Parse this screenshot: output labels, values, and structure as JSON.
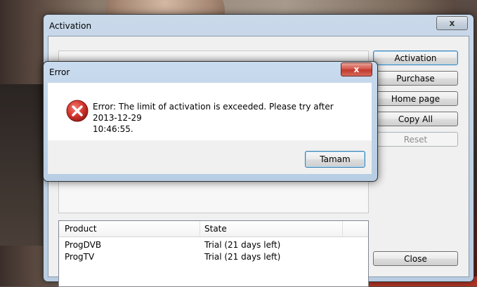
{
  "activation_window": {
    "title": "Activation",
    "close_symbol": "x",
    "buttons": {
      "activation": "Activation",
      "purchase": "Purchase",
      "home_page": "Home page",
      "copy_all": "Copy All",
      "reset": "Reset",
      "close": "Close"
    },
    "table": {
      "columns": [
        "Product",
        "State"
      ],
      "rows": [
        {
          "product": "ProgDVB",
          "state": "Trial (21 days left)"
        },
        {
          "product": "ProgTV",
          "state": "Trial (21 days left)"
        }
      ]
    }
  },
  "error_dialog": {
    "title": "Error",
    "close_symbol": "x",
    "message_line1": "Error: The limit of activation is exceeded. Please try after 2013-12-29",
    "message_line2": "10:46:55.",
    "ok_button": "Tamam",
    "icon": "error-icon"
  },
  "colors": {
    "error_icon_red": "#d0322a",
    "focus_blue": "#3c7fb1"
  }
}
